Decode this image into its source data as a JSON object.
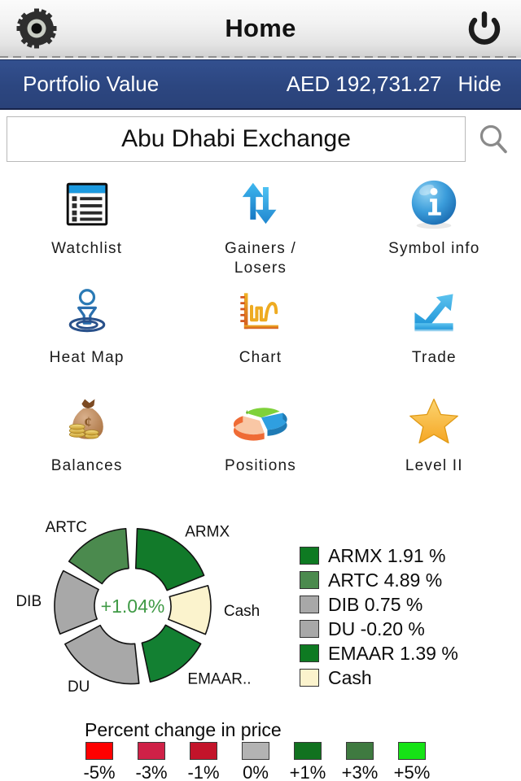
{
  "titlebar": {
    "settings_icon": "gear-icon",
    "title": "Home",
    "power_icon": "power-icon"
  },
  "portfolio": {
    "label": "Portfolio Value",
    "value": "AED 192,731.27",
    "hide_label": "Hide",
    "bar_color": "#2c4680"
  },
  "search": {
    "value": "Abu Dhabi Exchange",
    "placeholder": "Abu Dhabi Exchange",
    "icon": "search-icon"
  },
  "grid": {
    "items": [
      {
        "label": "Watchlist",
        "icon": "list-icon"
      },
      {
        "label": "Gainers /\nLosers",
        "icon": "up-down-arrows-icon"
      },
      {
        "label": "Symbol info",
        "icon": "info-icon"
      },
      {
        "label": "Heat Map",
        "icon": "heatmap-pin-icon"
      },
      {
        "label": "Chart",
        "icon": "line-chart-icon"
      },
      {
        "label": "Trade",
        "icon": "trend-up-icon"
      },
      {
        "label": "Balances",
        "icon": "money-bag-icon"
      },
      {
        "label": "Positions",
        "icon": "pie-chart-icon"
      },
      {
        "label": "Level II",
        "icon": "star-icon"
      }
    ]
  },
  "chart_data": {
    "type": "pie",
    "title": "",
    "subtype": "donut-exploded",
    "center_label": "+1.04%",
    "center_label_color": "#3f9a45",
    "categories": [
      "ARMX",
      "Cash",
      "EMAAR..",
      "DU",
      "DIB",
      "ARTC"
    ],
    "values": [
      18.6,
      10.6,
      14.0,
      19.0,
      14.0,
      15.3
    ],
    "slice_labels": [
      "ARMX",
      "Cash",
      "EMAAR..",
      "DU",
      "DIB",
      "ARTC"
    ],
    "colors": [
      "#127a2a",
      "#fbf3cd",
      "#138032",
      "#a8a8a8",
      "#a8a8a8",
      "#4b8a4e"
    ],
    "slices": [
      {
        "label": "ARMX",
        "start_deg": 2,
        "end_deg": 68,
        "color": "#127a2a"
      },
      {
        "label": "Cash",
        "start_deg": 74,
        "end_deg": 112,
        "color": "#fbf3cd"
      },
      {
        "label": "EMAAR..",
        "start_deg": 118,
        "end_deg": 168,
        "color": "#138032"
      },
      {
        "label": "DU",
        "start_deg": 174,
        "end_deg": 242,
        "color": "#a8a8a8"
      },
      {
        "label": "DIB",
        "start_deg": 248,
        "end_deg": 298,
        "color": "#a8a8a8"
      },
      {
        "label": "ARTC",
        "start_deg": 304,
        "end_deg": 356,
        "color": "#4b8a4e"
      }
    ],
    "legend_position": "right",
    "legend": [
      {
        "name": "ARMX",
        "text": "ARMX 1.91 %",
        "value": 1.91,
        "color": "#0e7a22"
      },
      {
        "name": "ARTC",
        "text": "ARTC 4.89 %",
        "value": 4.89,
        "color": "#4b8a4e"
      },
      {
        "name": "DIB",
        "text": "DIB 0.75 %",
        "value": 0.75,
        "color": "#a8a8a8"
      },
      {
        "name": "DU",
        "text": "DU -0.20 %",
        "value": -0.2,
        "color": "#a8a8a8"
      },
      {
        "name": "EMAAR",
        "text": "EMAAR 1.39 %",
        "value": 1.39,
        "color": "#0e7a22"
      },
      {
        "name": "Cash",
        "text": "Cash",
        "value": null,
        "color": "#fbf3cd"
      }
    ]
  },
  "scale": {
    "title": "Percent change in price",
    "items": [
      {
        "label": "-5%",
        "color": "#fe0000"
      },
      {
        "label": "-3%",
        "color": "#cf2147"
      },
      {
        "label": "-1%",
        "color": "#c3142a"
      },
      {
        "label": "0%",
        "color": "#b3b3b3"
      },
      {
        "label": "+1%",
        "color": "#11721f"
      },
      {
        "label": "+3%",
        "color": "#3f7a40"
      },
      {
        "label": "+5%",
        "color": "#16e316"
      }
    ]
  }
}
